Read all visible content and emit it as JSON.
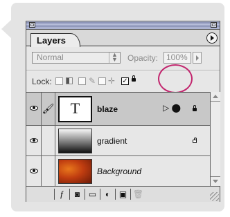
{
  "panel": {
    "tab_label": "Layers",
    "blend_mode": "Normal",
    "opacity_label": "Opacity:",
    "opacity_value": "100%",
    "lock_label": "Lock:"
  },
  "layers": [
    {
      "name": "blaze",
      "type": "text",
      "thumb": "T",
      "selected": true
    },
    {
      "name": "gradient",
      "type": "gradient",
      "selected": false
    },
    {
      "name": "Background",
      "type": "image",
      "selected": false
    }
  ],
  "icons": {
    "menu": "triangle-right-icon",
    "eye": "eye-icon",
    "brush": "brush-icon",
    "lock": "lock-icon",
    "effects": "effects-icon",
    "trash": "trash-icon"
  },
  "colors": {
    "highlight_circle": "#c2266e",
    "selected_row": "#c8c8c8"
  }
}
